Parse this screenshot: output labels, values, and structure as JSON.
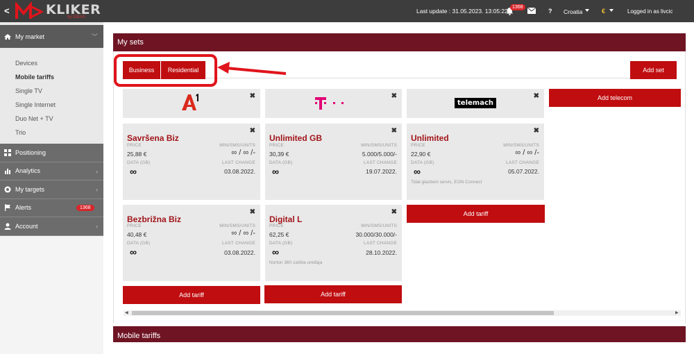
{
  "topbar": {
    "back": "<",
    "logo_text": "KLIKER",
    "logo_sub": "by IDEAS",
    "last_update": "Last update : 31.05.2023. 13:05:22",
    "notification_count": "1368",
    "help": "?",
    "country": "Croatia",
    "currency": "€",
    "logged_in": "Logged in as  livcic"
  },
  "sidebar": {
    "my_market": "My market",
    "items": [
      "Devices",
      "Mobile tariffs",
      "Single TV",
      "Single Internet",
      "Duo Net + TV",
      "Trio"
    ],
    "active_item": "Mobile tariffs",
    "sections": [
      {
        "label": "Positioning",
        "icon": "grid-icon"
      },
      {
        "label": "Analytics",
        "icon": "bar-chart-icon"
      },
      {
        "label": "My targets",
        "icon": "target-icon"
      },
      {
        "label": "Alerts",
        "icon": "flag-icon",
        "badge": "1368"
      },
      {
        "label": "Account",
        "icon": "user-icon"
      }
    ]
  },
  "main": {
    "title": "My sets",
    "tabs": [
      "Business",
      "Residential"
    ],
    "add_set": "Add set",
    "add_telecom": "Add telecom",
    "add_tariff": "Add tariff",
    "close_glyph": "✖",
    "labels": {
      "price": "PRICE",
      "min": "MIN/SMS/UNITS",
      "data": "DATA (GB)",
      "last_change": "LAST CHANGE"
    },
    "operators": [
      {
        "name": "A1",
        "logo": "a1-logo",
        "color": "#da291c"
      },
      {
        "name": "T",
        "logo": "telekom-logo",
        "color": "#e20074"
      },
      {
        "name": "telemach",
        "logo": "telemach-logo",
        "color": "#000000"
      }
    ],
    "tariffs": [
      [
        {
          "name": "Savršena Biz",
          "price": "25,88 €",
          "min_sms": "∞ / ∞ /-",
          "data": "∞",
          "last_change": "03.08.2022.",
          "note": ""
        },
        {
          "name": "Bezbrižna Biz",
          "price": "40,48 €",
          "min_sms": "∞ / ∞ /-",
          "data": "∞",
          "last_change": "03.08.2022.",
          "note": ""
        }
      ],
      [
        {
          "name": "Unlimited GB",
          "price": "30,39 €",
          "min_sms": "5.000/5.000/-",
          "data": "∞",
          "last_change": "19.07.2022.",
          "note": ""
        },
        {
          "name": "Digital L",
          "price": "62,25 €",
          "min_sms": "30.000/30.000/-",
          "data": "∞",
          "last_change": "28.10.2022.",
          "note": "Norton 360 zaštita uređaja"
        }
      ],
      [
        {
          "name": "Unlimited",
          "price": "22,90 €",
          "min_sms": "∞ / ∞ /-",
          "data": "∞",
          "last_change": "05.07.2022.",
          "note": "Tidal glazbeni servis, EON Connect"
        }
      ]
    ]
  },
  "second_panel": {
    "title": "Mobile tariffs"
  },
  "colors": {
    "accent": "#c00d10",
    "header": "#6e1423",
    "highlight": "#e0141c"
  }
}
